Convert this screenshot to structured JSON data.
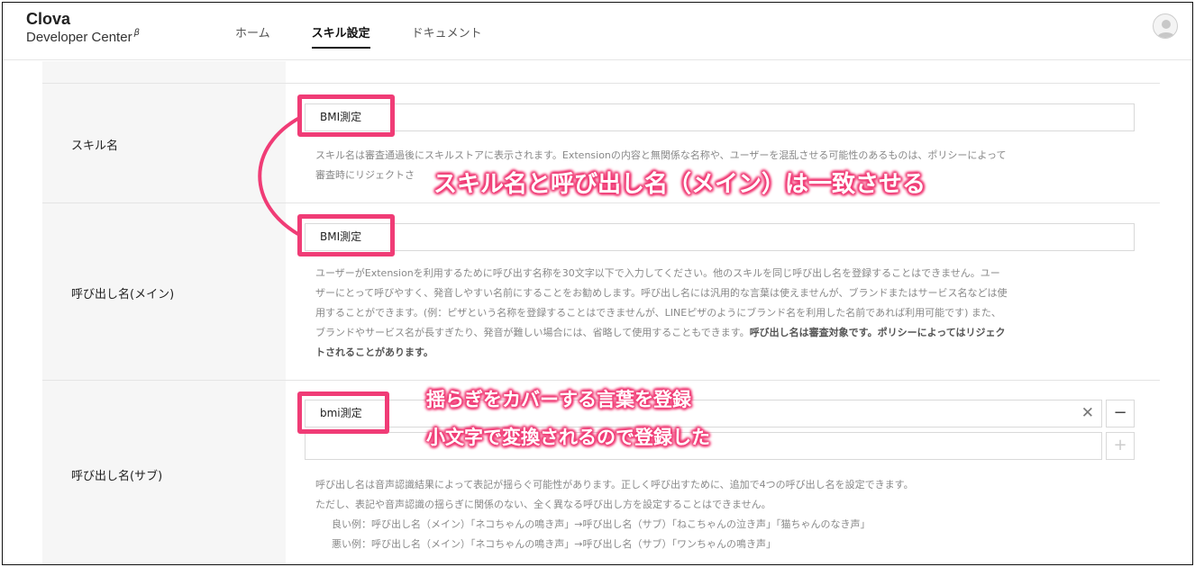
{
  "header": {
    "logo_title": "Clova",
    "logo_sub": "Developer Center",
    "logo_beta": "β",
    "nav": [
      {
        "label": "ホーム"
      },
      {
        "label": "スキル設定"
      },
      {
        "label": "ドキュメント"
      }
    ],
    "avatar_icon": "user-icon"
  },
  "form": {
    "skill_name": {
      "label": "スキル名",
      "value": "BMI測定",
      "desc_line1": "スキル名は審査通過後にスキルストアに表示されます。Extensionの内容と無関係な名称や、ユーザーを混乱させる可能性のあるものは、ポリシーによって",
      "desc_line2": "審査時にリジェクトさ"
    },
    "invocation_main": {
      "label": "呼び出し名(メイン)",
      "value": "BMI測定",
      "desc_line1": "ユーザーがExtensionを利用するために呼び出す名称を30文字以下で入力してください。他のスキルを同じ呼び出し名を登録することはできません。ユー",
      "desc_line2": "ザーにとって呼びやすく、発音しやすい名前にすることをお勧めします。呼び出し名には汎用的な言葉は使えませんが、ブランドまたはサービス名などは使",
      "desc_line3": "用することができます。(例：ピザという名称を登録することはできませんが、LINEピザのようにブランド名を利用した名前であれば利用可能です) また、",
      "desc_line4": "ブランドやサービス名が長すぎたり、発音が難しい場合には、省略して使用することもできます。",
      "desc_line4_bold": "呼び出し名は審査対象です。ポリシーによってはリジェク",
      "desc_line5_bold": "トされることがあります。"
    },
    "invocation_sub": {
      "label": "呼び出し名(サブ)",
      "value": "bmi測定",
      "value2": "",
      "clear_symbol": "✕",
      "minus_symbol": "−",
      "plus_symbol": "+",
      "desc_line1": "呼び出し名は音声認識結果によって表記が揺らぐ可能性があります。正しく呼び出すために、追加で4つの呼び出し名を設定できます。",
      "desc_line2": "ただし、表記や音声認識の揺らぎに関係のない、全く異なる呼び出し方を設定することはできません。",
      "desc_line3": "良い例：呼び出し名（メイン）「ネコちゃんの鳴き声」→呼び出し名（サブ）「ねこちゃんの泣き声」「猫ちゃんのなき声」",
      "desc_line4": "悪い例：呼び出し名（メイン）「ネコちゃんの鳴き声」→呼び出し名（サブ）「ワンちゃんの鳴き声」"
    }
  },
  "annotations": {
    "main_note": "スキル名と呼び出し名（メイン）は一致させる",
    "sub_note_line1": "揺らぎをカバーする言葉を登録",
    "sub_note_line2": "小文字で変換されるので登録した",
    "accent_color": "#f03c76"
  }
}
